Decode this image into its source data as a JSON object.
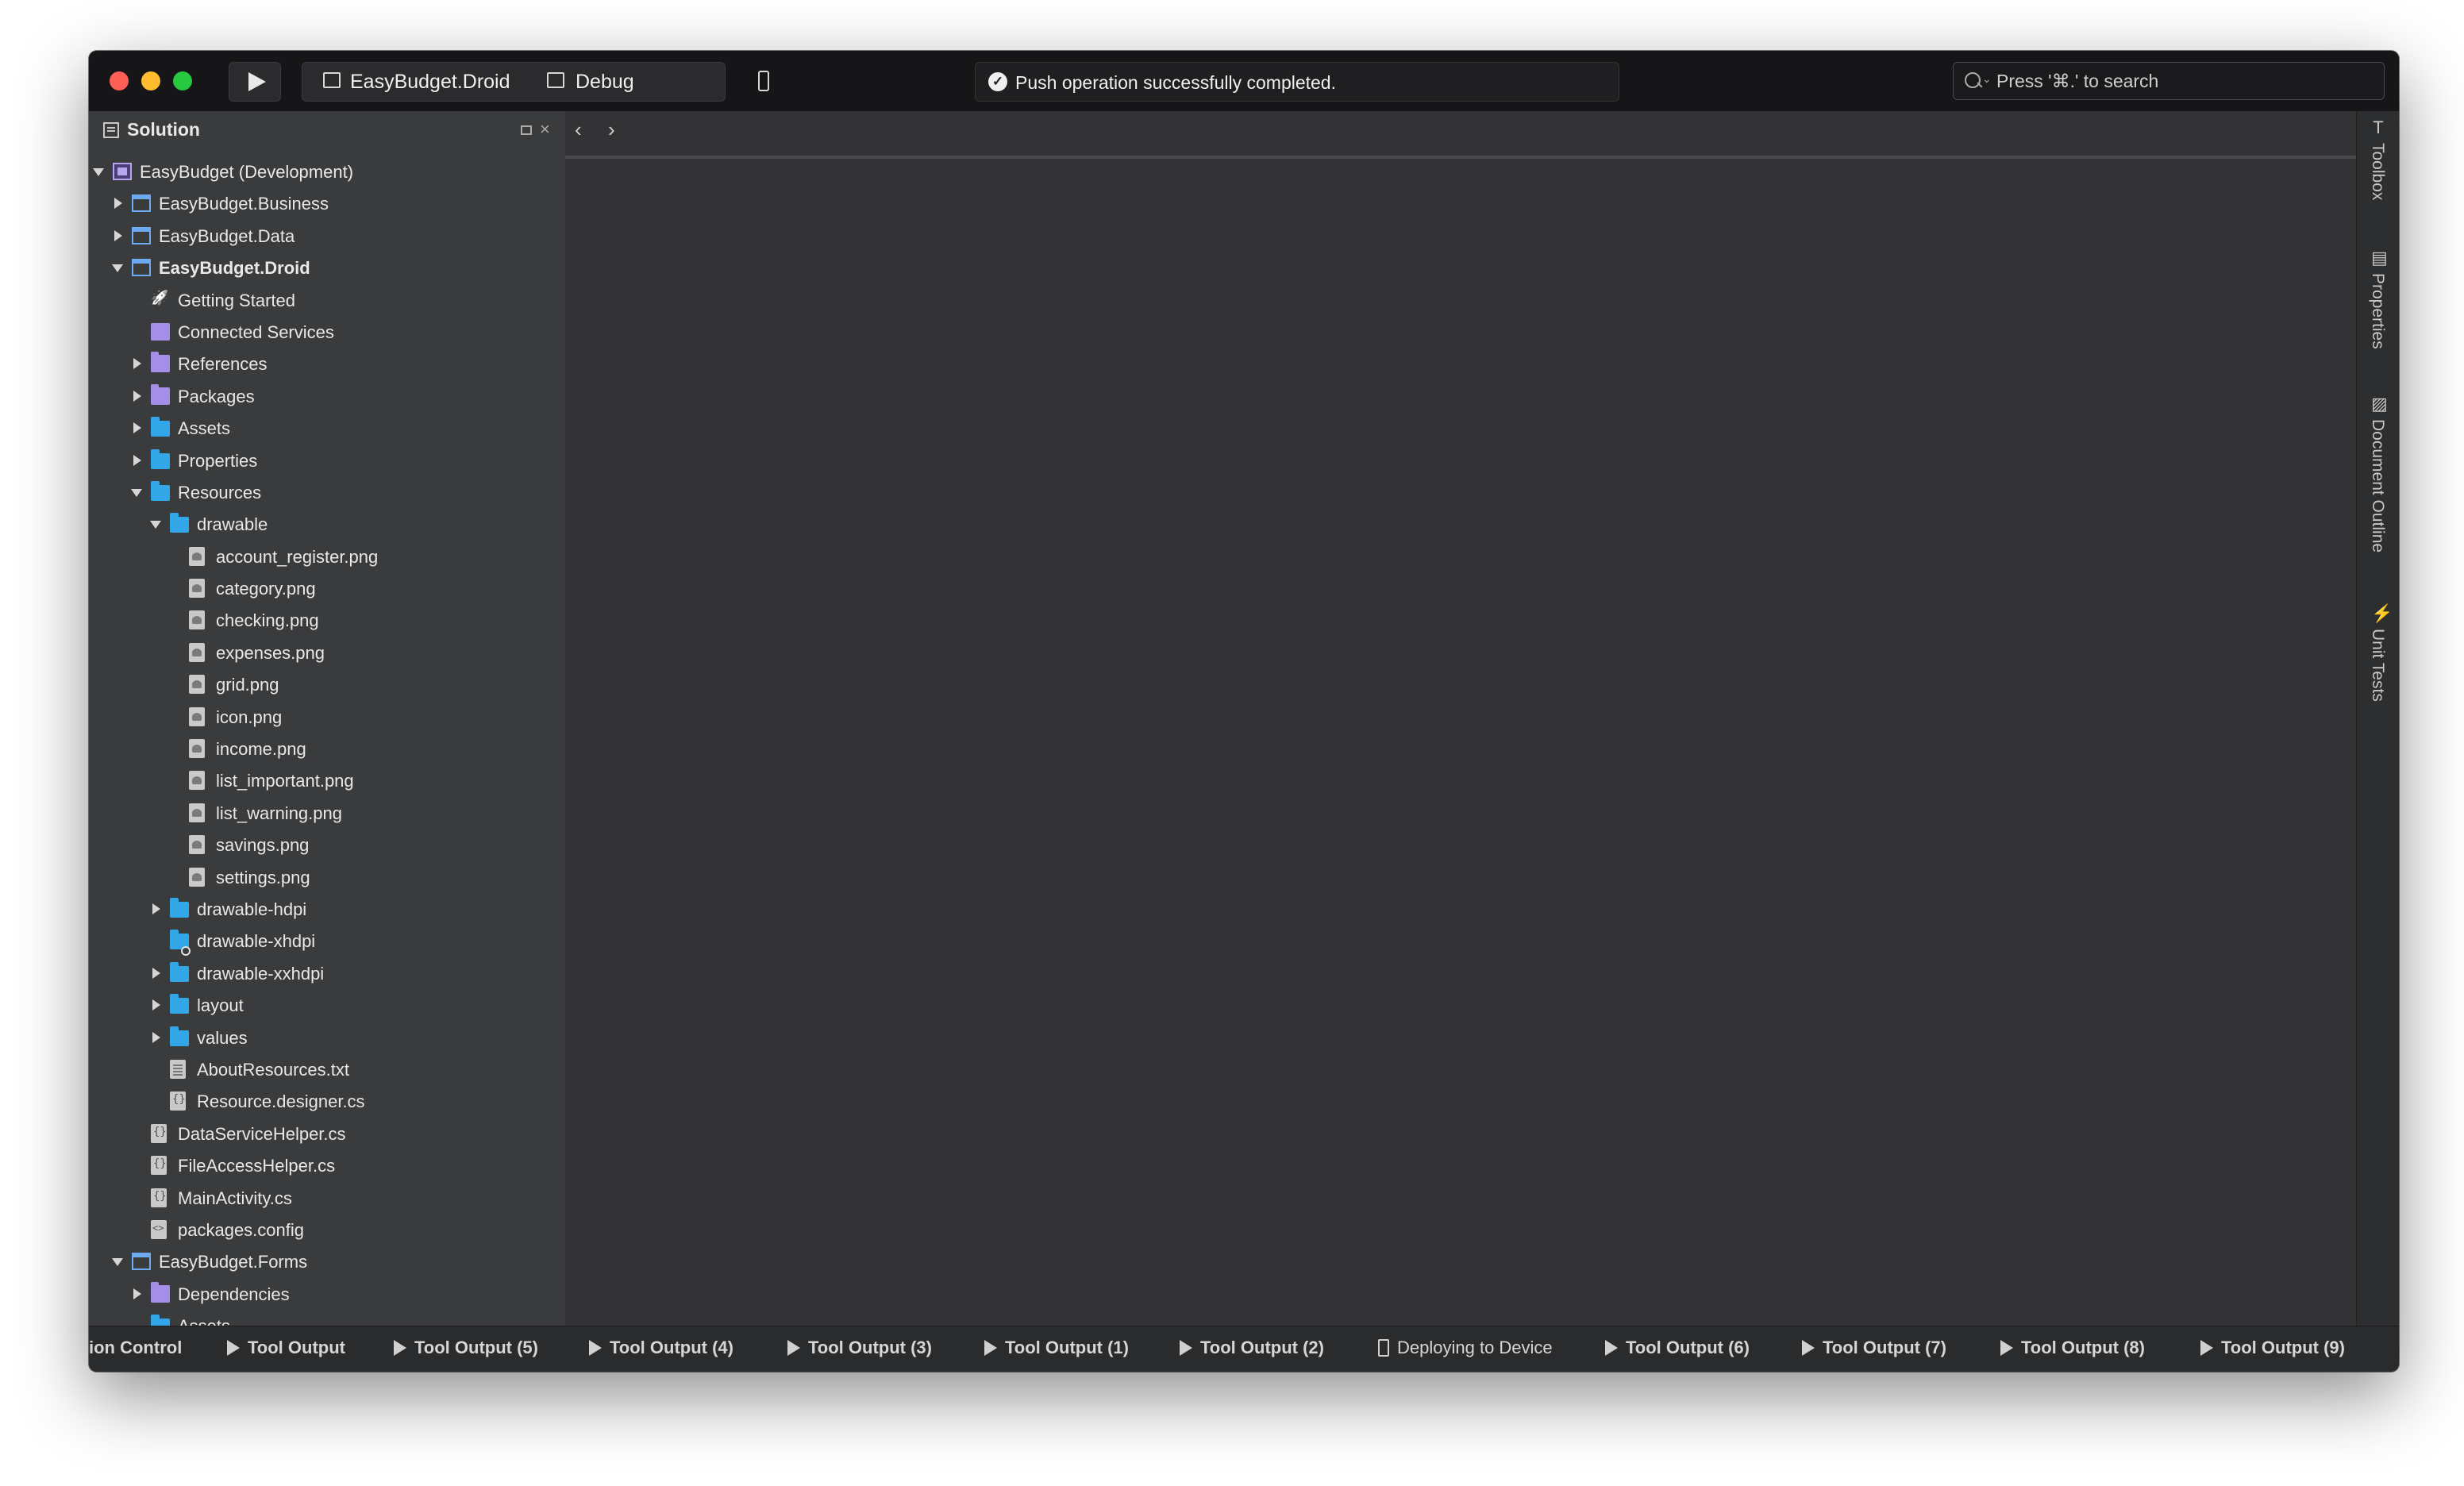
{
  "toolbar": {
    "project_config": "EasyBudget.Droid",
    "build_config": "Debug",
    "status_message": "Push operation successfully completed.",
    "search_placeholder": "Press '⌘.' to search"
  },
  "solution_pane": {
    "title": "Solution",
    "tree": [
      {
        "label": "EasyBudget (Development)",
        "arrow": "down",
        "icon": "solution",
        "bold": false
      },
      {
        "label": "EasyBudget.Business",
        "arrow": "right",
        "icon": "project",
        "bold": false
      },
      {
        "label": "EasyBudget.Data",
        "arrow": "right",
        "icon": "project",
        "bold": false
      },
      {
        "label": "EasyBudget.Droid",
        "arrow": "down",
        "icon": "project",
        "bold": true
      },
      {
        "label": "Getting Started",
        "arrow": "none",
        "icon": "rocket",
        "bold": false
      },
      {
        "label": "Connected Services",
        "arrow": "none",
        "icon": "purple",
        "bold": false
      },
      {
        "label": "References",
        "arrow": "right",
        "icon": "purple-folder",
        "bold": false
      },
      {
        "label": "Packages",
        "arrow": "right",
        "icon": "purple-folder",
        "bold": false
      },
      {
        "label": "Assets",
        "arrow": "right",
        "icon": "folder",
        "bold": false
      },
      {
        "label": "Properties",
        "arrow": "right",
        "icon": "folder",
        "bold": false
      },
      {
        "label": "Resources",
        "arrow": "down",
        "icon": "folder",
        "bold": false
      },
      {
        "label": "drawable",
        "arrow": "down",
        "icon": "folder",
        "bold": false
      },
      {
        "label": "account_register.png",
        "arrow": "none",
        "icon": "image-file",
        "bold": false
      },
      {
        "label": "category.png",
        "arrow": "none",
        "icon": "image-file",
        "bold": false
      },
      {
        "label": "checking.png",
        "arrow": "none",
        "icon": "image-file",
        "bold": false
      },
      {
        "label": "expenses.png",
        "arrow": "none",
        "icon": "image-file",
        "bold": false
      },
      {
        "label": "grid.png",
        "arrow": "none",
        "icon": "image-file",
        "bold": false
      },
      {
        "label": "icon.png",
        "arrow": "none",
        "icon": "image-file",
        "bold": false
      },
      {
        "label": "income.png",
        "arrow": "none",
        "icon": "image-file",
        "bold": false
      },
      {
        "label": "list_important.png",
        "arrow": "none",
        "icon": "image-file",
        "bold": false
      },
      {
        "label": "list_warning.png",
        "arrow": "none",
        "icon": "image-file",
        "bold": false
      },
      {
        "label": "savings.png",
        "arrow": "none",
        "icon": "image-file",
        "bold": false
      },
      {
        "label": "settings.png",
        "arrow": "none",
        "icon": "image-file",
        "bold": false
      },
      {
        "label": "drawable-hdpi",
        "arrow": "right",
        "icon": "folder",
        "bold": false
      },
      {
        "label": "drawable-xhdpi",
        "arrow": "none",
        "icon": "folder-badge",
        "bold": false
      },
      {
        "label": "drawable-xxhdpi",
        "arrow": "right",
        "icon": "folder",
        "bold": false
      },
      {
        "label": "layout",
        "arrow": "right",
        "icon": "folder",
        "bold": false
      },
      {
        "label": "values",
        "arrow": "right",
        "icon": "folder",
        "bold": false
      },
      {
        "label": "AboutResources.txt",
        "arrow": "none",
        "icon": "text-file",
        "bold": false
      },
      {
        "label": "Resource.designer.cs",
        "arrow": "none",
        "icon": "code-file",
        "bold": false
      },
      {
        "label": "DataServiceHelper.cs",
        "arrow": "none",
        "icon": "code-file",
        "bold": false
      },
      {
        "label": "FileAccessHelper.cs",
        "arrow": "none",
        "icon": "code-file",
        "bold": false
      },
      {
        "label": "MainActivity.cs",
        "arrow": "none",
        "icon": "code-file",
        "bold": false
      },
      {
        "label": "packages.config",
        "arrow": "none",
        "icon": "xml-file",
        "bold": false
      },
      {
        "label": "EasyBudget.Forms",
        "arrow": "down",
        "icon": "project",
        "bold": false
      },
      {
        "label": "Dependencies",
        "arrow": "right",
        "icon": "purple-folder",
        "bold": false
      },
      {
        "label": "Assets",
        "arrow": "none",
        "icon": "folder",
        "bold": false
      }
    ]
  },
  "right_panel": {
    "tabs": [
      {
        "label": "Toolbox",
        "icon": "T"
      },
      {
        "label": "Properties",
        "icon": "▤"
      },
      {
        "label": "Document Outline",
        "icon": "▨"
      },
      {
        "label": "Unit Tests",
        "icon": "⚡"
      }
    ]
  },
  "bottom_bar": {
    "items": [
      {
        "label": "ion Control",
        "icon": "none"
      },
      {
        "label": "Tool Output",
        "icon": "play"
      },
      {
        "label": "Tool Output (5)",
        "icon": "play"
      },
      {
        "label": "Tool Output (4)",
        "icon": "play"
      },
      {
        "label": "Tool Output (3)",
        "icon": "play"
      },
      {
        "label": "Tool Output (1)",
        "icon": "play"
      },
      {
        "label": "Tool Output (2)",
        "icon": "play"
      },
      {
        "label": "Deploying to Device",
        "icon": "deploy"
      },
      {
        "label": "Tool Output (6)",
        "icon": "play"
      },
      {
        "label": "Tool Output (7)",
        "icon": "play"
      },
      {
        "label": "Tool Output (8)",
        "icon": "play"
      },
      {
        "label": "Tool Output (9)",
        "icon": "play"
      }
    ]
  }
}
